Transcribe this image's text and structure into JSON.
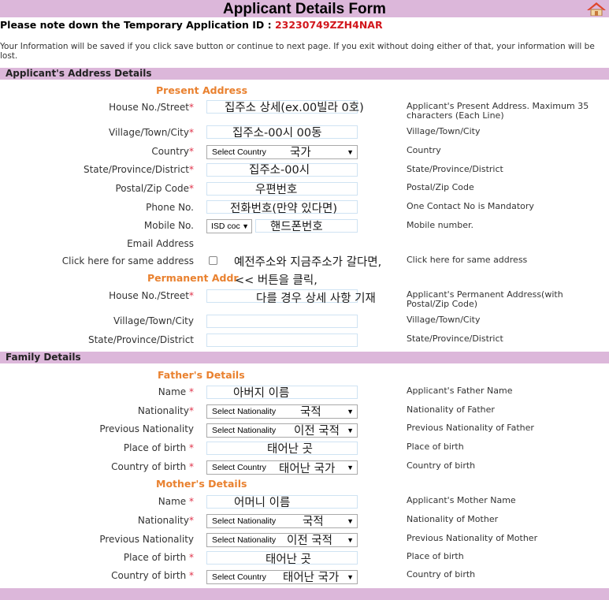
{
  "header": {
    "title": "Applicant Details Form",
    "home_icon": "home-icon"
  },
  "note": {
    "prefix": "Please note down the Temporary Application ID : ",
    "app_id": "23230749ZZH4NAR"
  },
  "info_text": "Your Information will be saved if you click save button or continue to next page. If you exit without doing either of that, your information will be lost.",
  "address_section": {
    "title": "Applicant's Address Details",
    "present_title": "Present Address",
    "permanent_title": "Permanent Addr",
    "present": {
      "house_label": "House No./Street",
      "village_label": "Village/Town/City",
      "country_label": "Country",
      "state_label": "State/Province/District",
      "postal_label": "Postal/Zip Code",
      "phone_label": "Phone No.",
      "mobile_label": "Mobile No.",
      "email_label": "Email Address",
      "same_label": "Click here for same address",
      "country_select": "Select Country",
      "isd_select": "ISD coc",
      "help_house": "Applicant's Present Address. Maximum 35 characters (Each Line)",
      "help_village": "Village/Town/City",
      "help_country": "Country",
      "help_state": "State/Province/District",
      "help_postal": "Postal/Zip Code",
      "help_phone": "One Contact No is Mandatory",
      "help_mobile": "Mobile number.",
      "help_same": "Click here for same address"
    },
    "permanent": {
      "house_label": "House No./Street",
      "village_label": "Village/Town/City",
      "state_label": "State/Province/District",
      "help_house": "Applicant's Permanent Address(with Postal/Zip Code)",
      "help_village": "Village/Town/City",
      "help_state": "State/Province/District"
    }
  },
  "family_section": {
    "title": "Family Details",
    "father_title": "Father's Details",
    "mother_title": "Mother's Details",
    "name_label": "Name",
    "nationality_label": "Nationality",
    "prev_nationality_label": "Previous Nationality",
    "birth_place_label": "Place of birth",
    "birth_country_label": "Country of birth",
    "select_nationality": "Select Nationality",
    "select_country": "Select Country",
    "father_help": {
      "name": "Applicant's Father Name",
      "nationality": "Nationality of Father",
      "prev": "Previous Nationality of Father",
      "place": "Place of birth",
      "country": "Country of birth"
    },
    "mother_help": {
      "name": "Applicant's Mother Name",
      "nationality": "Nationality of Mother",
      "prev": "Previous Nationality of Mother",
      "place": "Place of birth",
      "country": "Country of birth"
    }
  },
  "annotations": {
    "present_house": "집주소 상세(ex.00빌라 0호)",
    "present_village": "집주소-00시 00동",
    "present_country": "국가",
    "present_state": "집주소-00시",
    "present_postal": "우편번호",
    "present_phone": "전화번호(만약 있다면)",
    "present_mobile": "핸드폰번호",
    "same_line1": "예전주소와 지금주소가 갈다면,",
    "same_line2": "<< 버튼을 클릭,",
    "same_line3": "다를 경우 상세 사항 기재",
    "father_name": "아버지 이름",
    "father_nationality": "국적",
    "father_prev": "이전 국적",
    "father_place": "태어난 곳",
    "father_country": "태어난 국가",
    "mother_name": "어머니 이름",
    "mother_nationality": "국적",
    "mother_prev": "이전 국적",
    "mother_place": "태어난 곳",
    "mother_country": "태어난 국가"
  },
  "colors": {
    "header_bg": "#dcb7da",
    "accent": "#e9812f",
    "required": "#e0334a",
    "app_id": "#d2171d"
  }
}
